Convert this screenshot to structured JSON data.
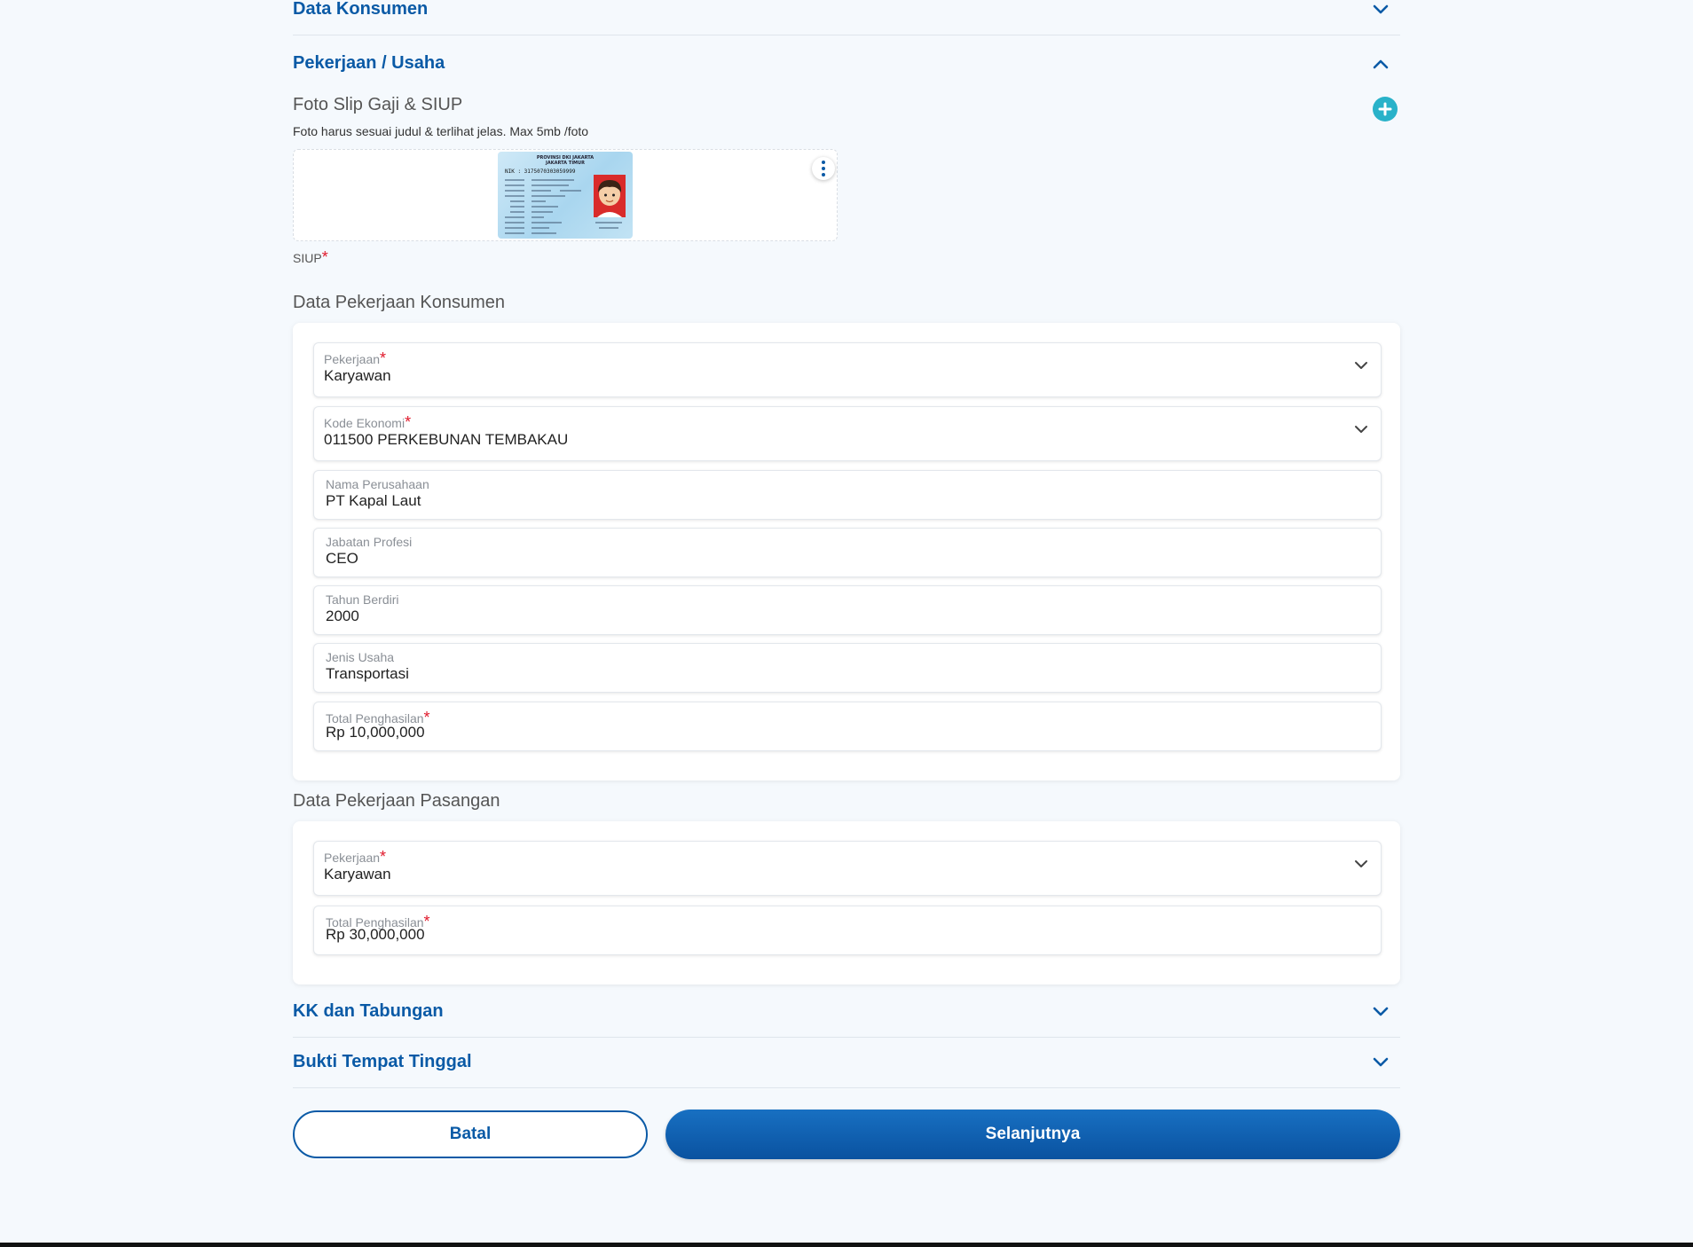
{
  "sections": {
    "data_konsumen": "Data Konsumen",
    "pekerjaan_usaha": "Pekerjaan / Usaha",
    "kk_tabungan": "KK dan Tabungan",
    "bukti_tinggal": "Bukti Tempat Tinggal"
  },
  "photo": {
    "title": "Foto Slip Gaji & SIUP",
    "note": "Foto harus sesuai judul & terlihat jelas. Max 5mb /foto",
    "caption": "SIUP",
    "required_mark": "*",
    "card_header_1": "PROVINSI DKI JAKARTA",
    "card_header_2": "JAKARTA TIMUR",
    "card_nik": "NIK  :  3175070303059999"
  },
  "konsumen": {
    "title": "Data Pekerjaan Konsumen",
    "pekerjaan_label": "Pekerjaan",
    "pekerjaan_value": "Karyawan",
    "kode_label": "Kode Ekonomi",
    "kode_value": "011500 PERKEBUNAN TEMBAKAU",
    "perusahaan_label": "Nama Perusahaan",
    "perusahaan_value": "PT Kapal Laut",
    "jabatan_label": "Jabatan Profesi",
    "jabatan_value": "CEO",
    "tahun_label": "Tahun Berdiri",
    "tahun_value": "2000",
    "jenis_label": "Jenis Usaha",
    "jenis_value": "Transportasi",
    "penghasilan_label": "Total Penghasilan",
    "penghasilan_value": "Rp 10,000,000"
  },
  "pasangan": {
    "title": "Data Pekerjaan Pasangan",
    "pekerjaan_label": "Pekerjaan",
    "pekerjaan_value": "Karyawan",
    "penghasilan_label": "Total Penghasilan",
    "penghasilan_value": "Rp 30,000,000"
  },
  "buttons": {
    "batal": "Batal",
    "selanjutnya": "Selanjutnya"
  },
  "colors": {
    "accent": "#0a5aa6",
    "plus": "#29b2c9",
    "required": "#e0192b"
  }
}
